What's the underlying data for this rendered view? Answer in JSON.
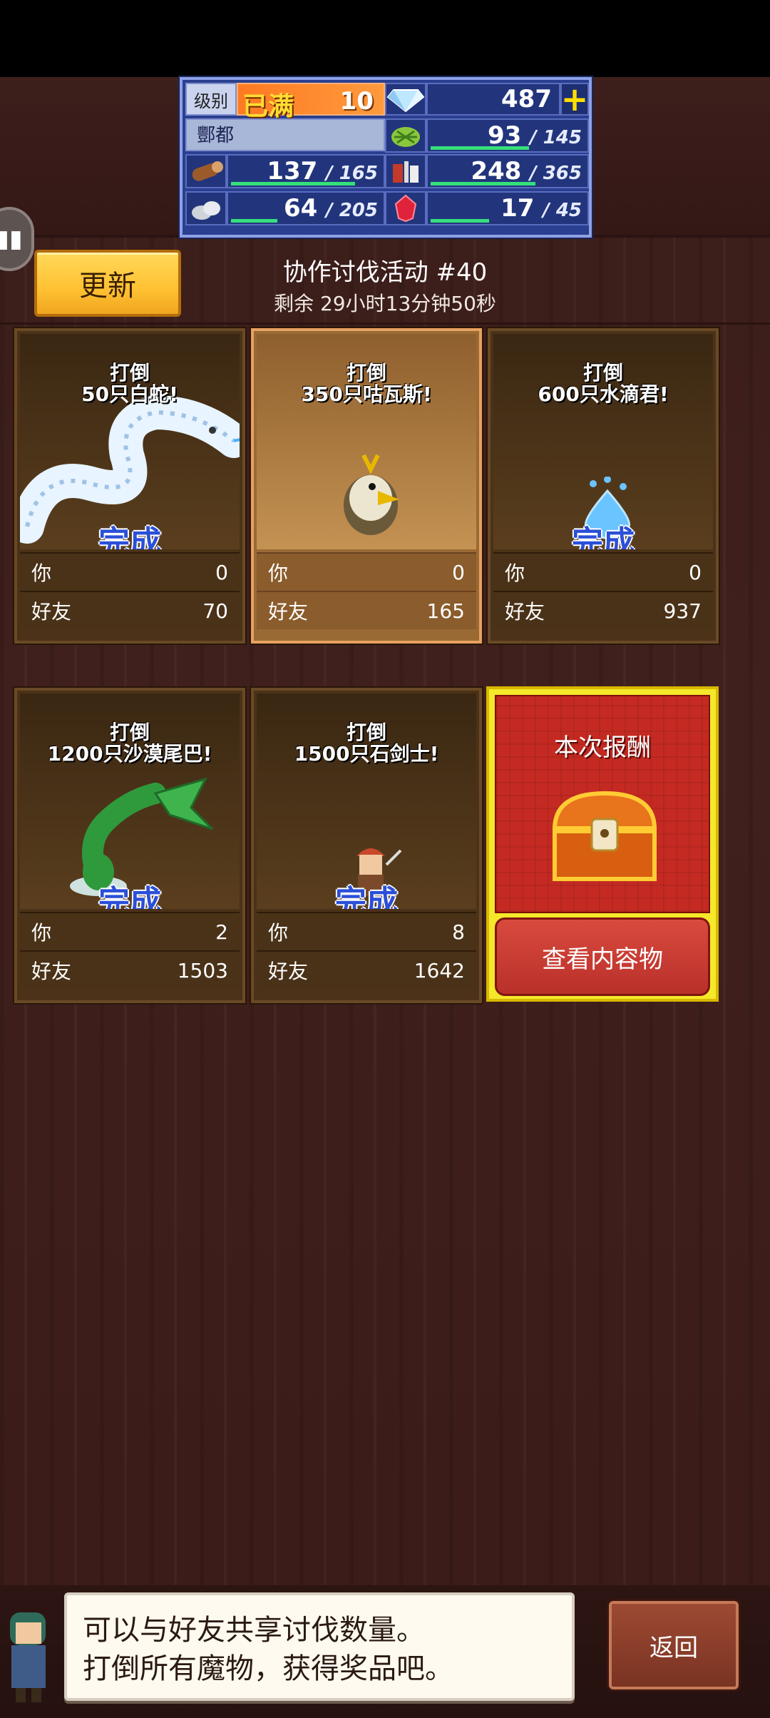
{
  "resources": {
    "level_label": "级别",
    "level_badge": "已满",
    "level_value": "10",
    "gems": "487",
    "gems_add": "+",
    "city_name": "酆都",
    "rows": [
      {
        "left_icon": "wood-icon",
        "left_value": "137",
        "left_max": "/ 165",
        "left_fill": 0.83,
        "right_icon": "grass-icon",
        "right_value": "93",
        "right_max": "/ 145",
        "right_fill": 0.64
      },
      {
        "left_icon": "stone-icon",
        "left_value": "64",
        "left_max": "/ 205",
        "left_fill": 0.31,
        "right_icon": "food-icon",
        "right_value": "248",
        "right_max": "/ 365",
        "right_fill": 0.68
      },
      {
        "left_icon": "",
        "left_value": "",
        "left_max": "",
        "left_fill": 0,
        "right_icon": "ruby-icon",
        "right_value": "17",
        "right_max": "/ 45",
        "right_fill": 0.38
      }
    ]
  },
  "header": {
    "update_label": "更新",
    "event_title": "协作讨伐活动 #40",
    "remaining": "剩余 29小时13分钟50秒"
  },
  "cards": [
    {
      "title_line1": "打倒",
      "title_line2": "50只白蛇!",
      "complete": "完成",
      "you_label": "你",
      "you_value": "0",
      "friend_label": "好友",
      "friend_value": "70",
      "monster": "white-snake-icon"
    },
    {
      "title_line1": "打倒",
      "title_line2": "350只咕瓦斯!",
      "complete": "",
      "you_label": "你",
      "you_value": "0",
      "friend_label": "好友",
      "friend_value": "165",
      "monster": "bird-icon"
    },
    {
      "title_line1": "打倒",
      "title_line2": "600只水滴君!",
      "complete": "完成",
      "you_label": "你",
      "you_value": "0",
      "friend_label": "好友",
      "friend_value": "937",
      "monster": "water-drop-icon"
    },
    {
      "title_line1": "打倒",
      "title_line2": "1200只沙漠尾巴!",
      "complete": "完成",
      "you_label": "你",
      "you_value": "2",
      "friend_label": "好友",
      "friend_value": "1503",
      "monster": "desert-tail-icon"
    },
    {
      "title_line1": "打倒",
      "title_line2": "1500只石剑士!",
      "complete": "完成",
      "you_label": "你",
      "you_value": "8",
      "friend_label": "好友",
      "friend_value": "1642",
      "monster": "stone-swordsman-icon"
    }
  ],
  "reward": {
    "title": "本次报酬",
    "view_button": "查看内容物"
  },
  "footer": {
    "speech_line1": "可以与好友共享讨伐数量。",
    "speech_line2": "打倒所有魔物，获得奖品吧。",
    "back_label": "返回"
  }
}
